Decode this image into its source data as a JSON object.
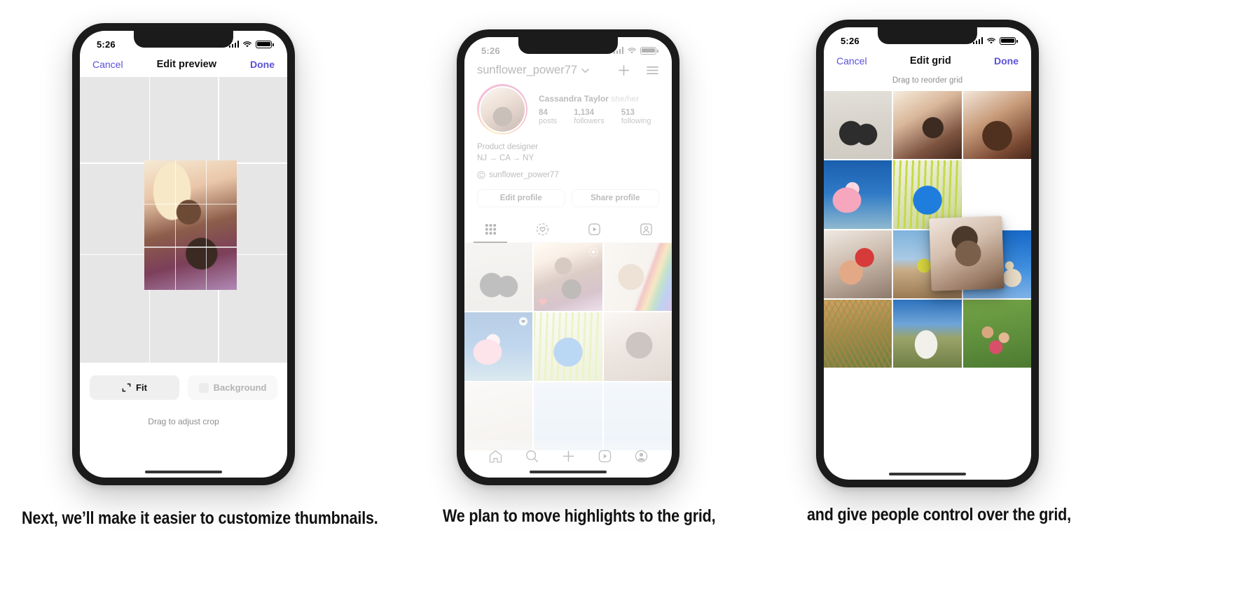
{
  "meta": {
    "accent_purple": "#5b51d8",
    "text_dark": "#111111",
    "text_muted": "#8e8e8e"
  },
  "captions": {
    "one": "Next, we’ll  make it easier to customize thumbnails.",
    "two": "We plan to move highlights to the grid,",
    "three": "and give people  control over the grid,"
  },
  "phone1": {
    "status": {
      "time": "5:26"
    },
    "nav": {
      "cancel": "Cancel",
      "title": "Edit preview",
      "done": "Done"
    },
    "controls": {
      "fit": "Fit",
      "background": "Background",
      "fit_icon": "crop-expand-icon"
    },
    "hint": "Drag to adjust crop"
  },
  "phone2": {
    "status": {
      "time": "5:26"
    },
    "header": {
      "username": "sunflower_power77",
      "chevron_icon": "chevron-down-icon",
      "add_icon": "plus-icon",
      "menu_icon": "hamburger-menu-icon"
    },
    "profile": {
      "name": "Cassandra Taylor",
      "pronouns": "she/her",
      "stats": [
        {
          "value": "84",
          "label": "posts"
        },
        {
          "value": "1,134",
          "label": "followers"
        },
        {
          "value": "513",
          "label": "following"
        }
      ],
      "bio_line1": "Product designer",
      "bio_line2": "NJ → CA → NY",
      "threads_handle": "sunflower_power77",
      "threads_icon": "threads-icon"
    },
    "buttons": {
      "edit_profile": "Edit profile",
      "share_profile": "Share profile"
    },
    "tabs": [
      {
        "name": "grid-tab",
        "icon": "grid-icon",
        "active": true
      },
      {
        "name": "highlights-tab",
        "icon": "highlight-heart-icon",
        "active": false
      },
      {
        "name": "reels-tab",
        "icon": "reels-play-icon",
        "active": false
      },
      {
        "name": "tagged-tab",
        "icon": "tagged-person-icon",
        "active": false
      }
    ],
    "grid": [
      {
        "art": "a-shadow",
        "badge": ""
      },
      {
        "art": "a-friends2",
        "badge": "highlight-ring-icon"
      },
      {
        "art": "a-pride",
        "badge": ""
      },
      {
        "art": "a-flower",
        "badge": "highlight-heart-icon"
      },
      {
        "art": "a-circle",
        "badge": ""
      },
      {
        "art": "a-curl",
        "badge": ""
      },
      {
        "art": "a-soft",
        "badge": ""
      },
      {
        "art": "a-lightblue",
        "badge": ""
      },
      {
        "art": "a-lightblue",
        "badge": ""
      }
    ],
    "bottom_nav": [
      {
        "name": "home-nav-icon"
      },
      {
        "name": "search-nav-icon"
      },
      {
        "name": "create-nav-icon"
      },
      {
        "name": "reels-nav-icon"
      },
      {
        "name": "profile-nav-icon"
      }
    ]
  },
  "phone3": {
    "status": {
      "time": "5:26"
    },
    "nav": {
      "cancel": "Cancel",
      "title": "Edit grid",
      "done": "Done"
    },
    "hint": "Drag to reorder grid",
    "grid": [
      {
        "art": "a-shadow"
      },
      {
        "art": "a-kiss"
      },
      {
        "art": "a-profile"
      },
      {
        "art": "a-flower"
      },
      {
        "art": "a-circle"
      },
      {
        "art": ""
      },
      {
        "art": "a-handcup"
      },
      {
        "art": "a-building"
      },
      {
        "art": "a-sky"
      },
      {
        "art": "a-grass"
      },
      {
        "art": "a-dog"
      },
      {
        "art": "a-grassgroup"
      }
    ],
    "dragging_tile": {
      "art": "a-portrait",
      "name": "dragged-grid-tile"
    }
  }
}
